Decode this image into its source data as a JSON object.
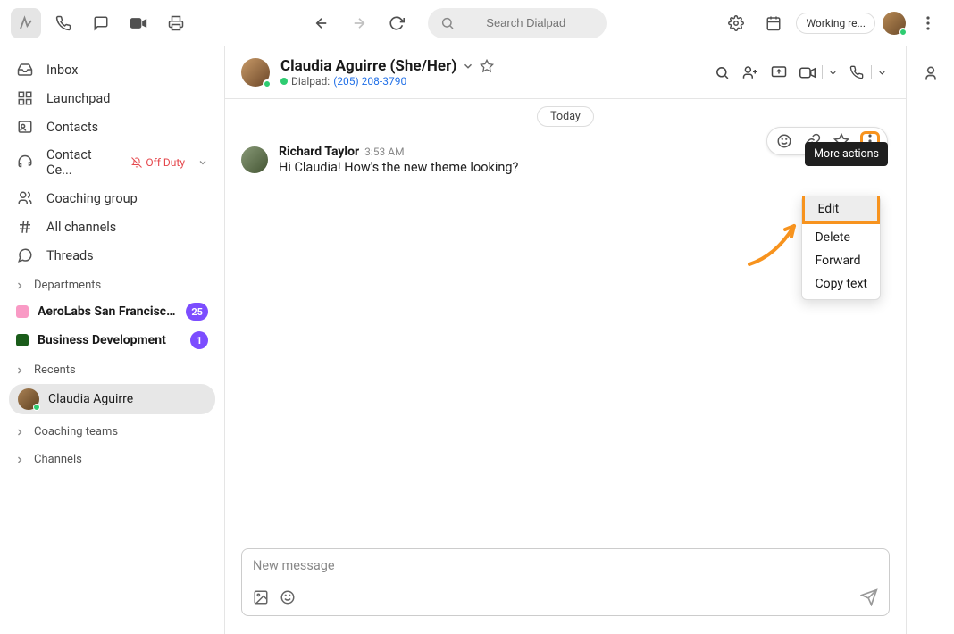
{
  "topbar": {
    "search_placeholder": "Search Dialpad",
    "status": "Working re..."
  },
  "sidebar": {
    "nav": [
      {
        "label": "Inbox"
      },
      {
        "label": "Launchpad"
      },
      {
        "label": "Contacts"
      },
      {
        "label": "Contact Ce...",
        "off_duty": "Off Duty"
      },
      {
        "label": "Coaching group"
      },
      {
        "label": "All channels"
      },
      {
        "label": "Threads"
      }
    ],
    "sections": {
      "departments": "Departments",
      "recents": "Recents",
      "coaching_teams": "Coaching teams",
      "channels": "Channels"
    },
    "departments": [
      {
        "label": "AeroLabs San Francisco CA",
        "badge": "25",
        "color": "#f99ac5"
      },
      {
        "label": "Business Development",
        "badge": "1",
        "color": "#1a5c1a"
      }
    ],
    "recents": [
      {
        "label": "Claudia Aguirre"
      }
    ]
  },
  "conversation": {
    "contact_name": "Claudia Aguirre (She/Her)",
    "sub_prefix": "Dialpad:",
    "phone": "(205) 208-3790",
    "day_label": "Today",
    "message": {
      "author": "Richard Taylor",
      "time": "3:53 AM",
      "text": "Hi Claudia! How's the new theme looking?"
    },
    "tooltip": "More actions",
    "menu": {
      "edit": "Edit",
      "delete": "Delete",
      "forward": "Forward",
      "copy": "Copy text"
    },
    "composer_placeholder": "New message"
  }
}
